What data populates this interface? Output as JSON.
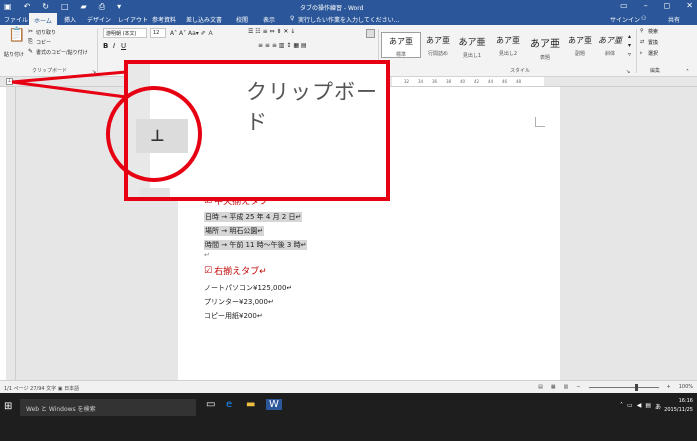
{
  "window": {
    "title": "タブの操作練習 - Word",
    "help_prompt": "実行したい作業を入力してください..."
  },
  "tabs": [
    "ファイル",
    "ホーム",
    "挿入",
    "デザイン",
    "レイアウト",
    "参考資料",
    "差し込み文書",
    "校閲",
    "表示"
  ],
  "user": {
    "signin": "サインイン",
    "share": "共有"
  },
  "ribbon": {
    "clipboard": {
      "paste": "貼り付け",
      "cut": "切り取り",
      "copy": "コピー",
      "format_painter": "書式のコピー/貼り付け",
      "label": "クリップボード"
    },
    "font": {
      "name": "游明朝 (本文(",
      "size": "12"
    },
    "styles": [
      {
        "sample": "あア亜",
        "name": "標準"
      },
      {
        "sample": "あア亜",
        "name": "行間詰め"
      },
      {
        "sample": "あア亜",
        "name": "見出し1"
      },
      {
        "sample": "あア亜",
        "name": "見出し2"
      },
      {
        "sample": "あア亜",
        "name": "表題"
      },
      {
        "sample": "あア亜",
        "name": "副題"
      },
      {
        "sample": "あア亜",
        "name": "斜体"
      }
    ],
    "styles_label": "スタイル",
    "editing": {
      "find": "検索",
      "replace": "置換",
      "select": "選択",
      "label": "編集"
    }
  },
  "ruler_numbers": [
    "32",
    "34",
    "36",
    "38",
    "40",
    "42",
    "44",
    "46",
    "48"
  ],
  "callout": {
    "title": "クリップボード",
    "tab_stop": "⊥"
  },
  "document": {
    "heading1": "中央揃えタブ",
    "lines1": [
      "日時 → 平成 25 年 4 月 2 日↵",
      "場所 → 明石公園↵",
      "時間 → 午前 11 時～午後 3 時↵"
    ],
    "heading2": "右揃えタブ↵",
    "lines2": [
      "ノートパソコン¥125,000↵",
      "プリンター¥23,000↵",
      "コピー用紙¥200↵"
    ]
  },
  "status": {
    "page": "1/1 ページ",
    "words": "27/94 文字",
    "language": "日本語",
    "zoom": "100%",
    "zoom_level_percent": 100
  },
  "taskbar": {
    "search": "Web と Windows を検索",
    "time": "16:16",
    "date": "2015/11/25",
    "ime": "あ"
  },
  "colors": {
    "word_blue": "#2b579a",
    "callout_red": "#e60012",
    "heading_red": "#c00000"
  }
}
